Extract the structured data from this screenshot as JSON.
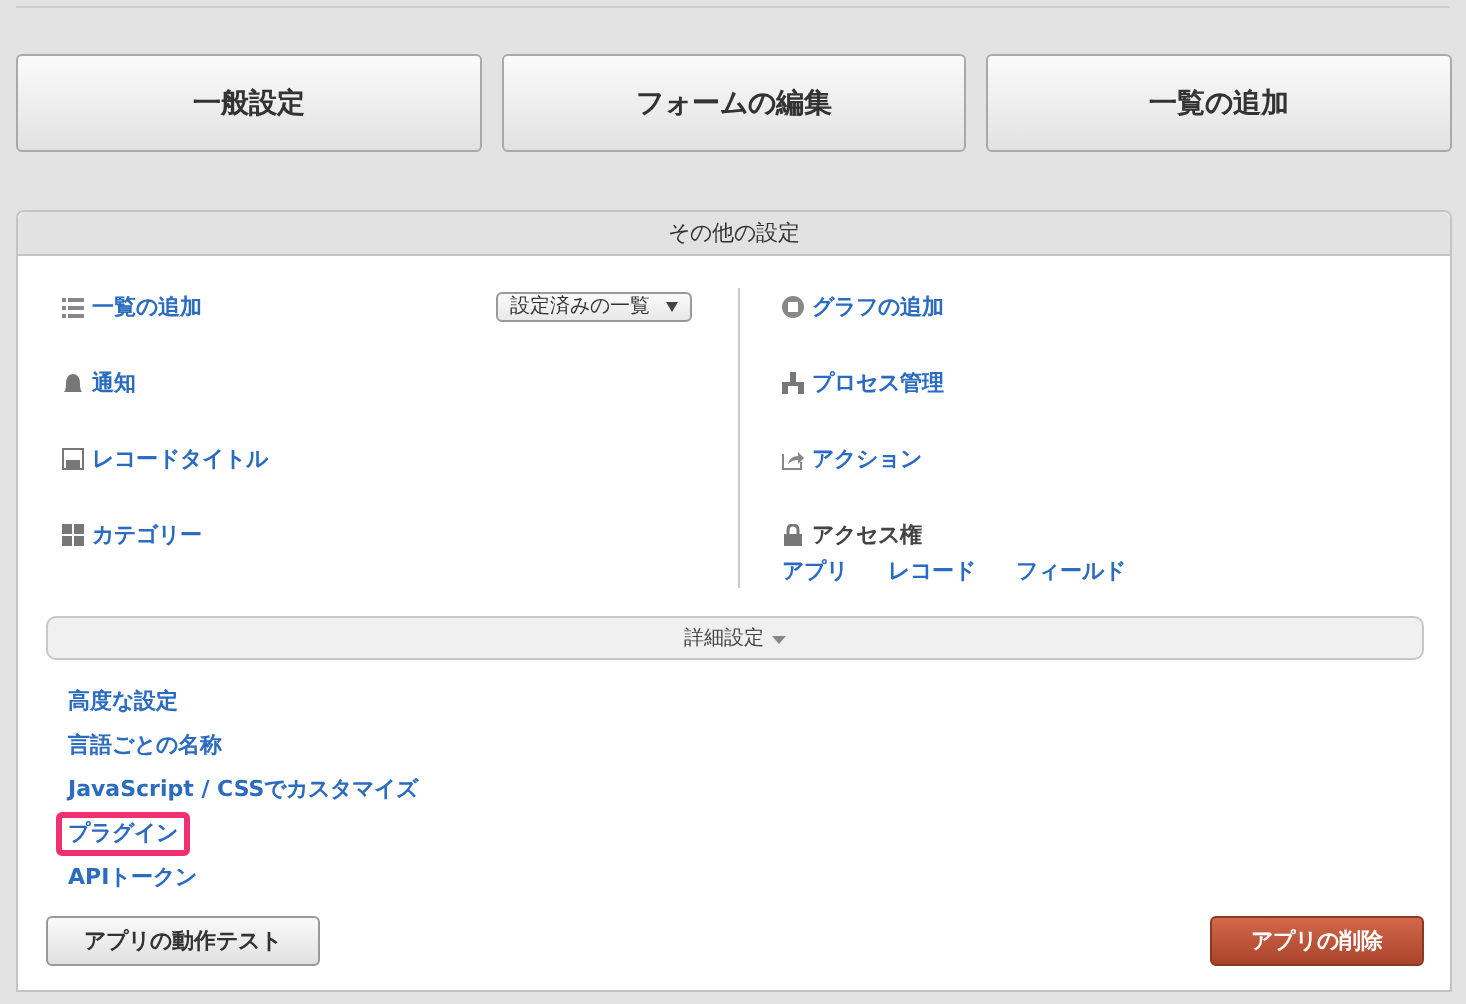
{
  "top_buttons": [
    "一般設定",
    "フォームの編集",
    "一覧の追加"
  ],
  "panel": {
    "title": "その他の設定",
    "left_items": [
      {
        "kind": "list",
        "label": "一覧の追加",
        "dropdown": "設定済みの一覧"
      },
      {
        "kind": "bell",
        "label": "通知"
      },
      {
        "kind": "floppy",
        "label": "レコードタイトル"
      },
      {
        "kind": "grid",
        "label": "カテゴリー"
      }
    ],
    "right_items": [
      {
        "kind": "chart",
        "label": "グラフの追加"
      },
      {
        "kind": "process",
        "label": "プロセス管理"
      },
      {
        "kind": "share",
        "label": "アクション"
      },
      {
        "kind": "lock",
        "label": "アクセス権",
        "links": [
          "アプリ",
          "レコード",
          "フィールド"
        ]
      }
    ],
    "details": {
      "label": "詳細設定",
      "expanded": true,
      "links": [
        {
          "label": "高度な設定",
          "highlighted": false
        },
        {
          "label": "言語ごとの名称",
          "highlighted": false
        },
        {
          "label": "JavaScript / CSSでカスタマイズ",
          "highlighted": false
        },
        {
          "label": "プラグイン",
          "highlighted": true
        },
        {
          "label": "APIトークン",
          "highlighted": false
        }
      ]
    },
    "test_button": "アプリの動作テスト",
    "delete_button": "アプリの削除"
  }
}
